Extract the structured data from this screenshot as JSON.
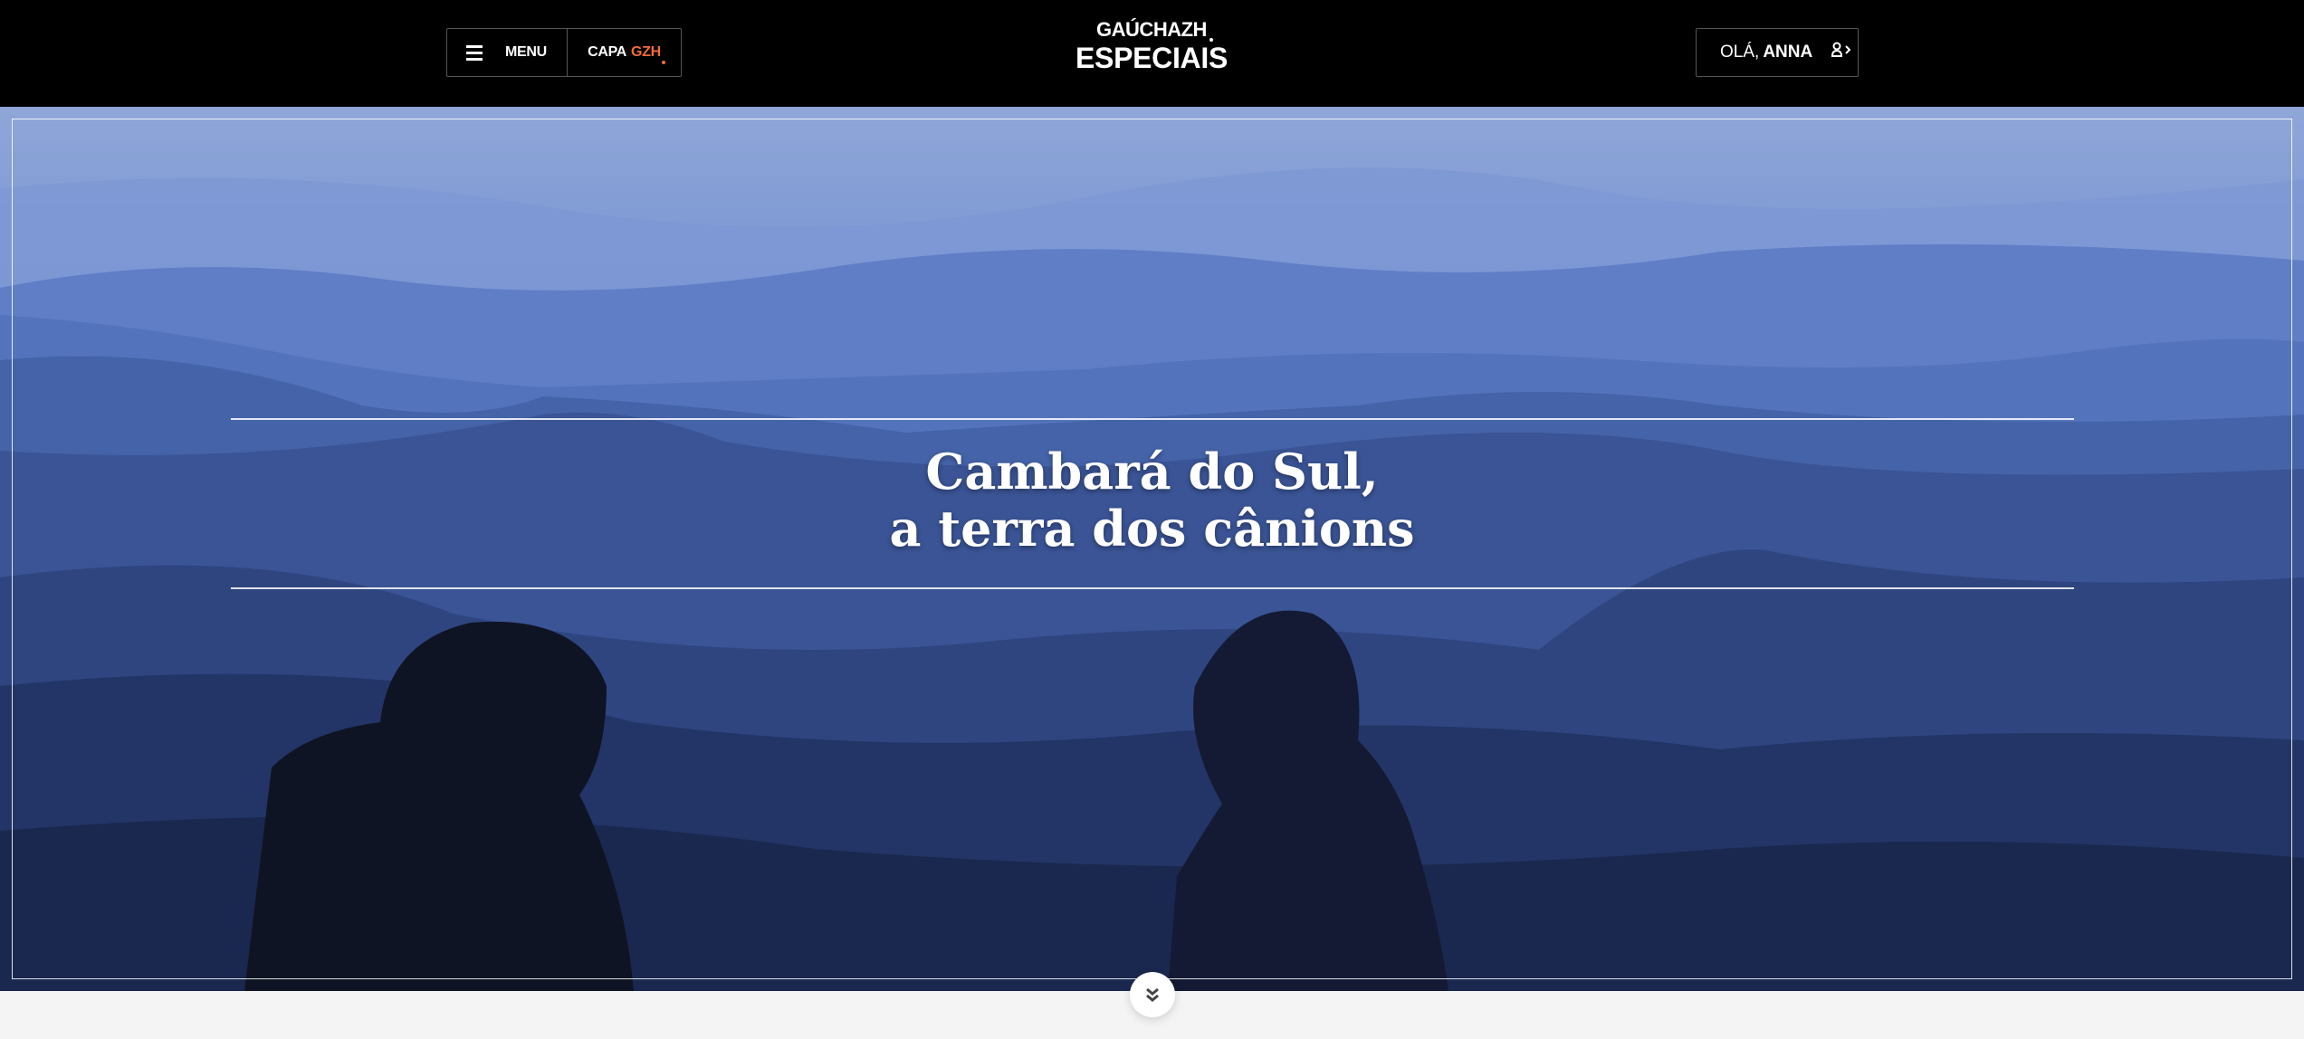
{
  "header": {
    "menu_label": "MENU",
    "capa_label": "CAPA",
    "capa_brand": "GZH",
    "logo_top": "GAÚCHAZH",
    "logo_bottom": "ESPECIAIS",
    "greeting": "OLÁ,",
    "user_name": "ANNA"
  },
  "hero": {
    "title_line1": "Cambará do Sul,",
    "title_line2": "a terra dos cânions"
  },
  "colors": {
    "accent": "#f26b3a",
    "header_bg": "#000000",
    "page_bg": "#f4f4f4"
  }
}
